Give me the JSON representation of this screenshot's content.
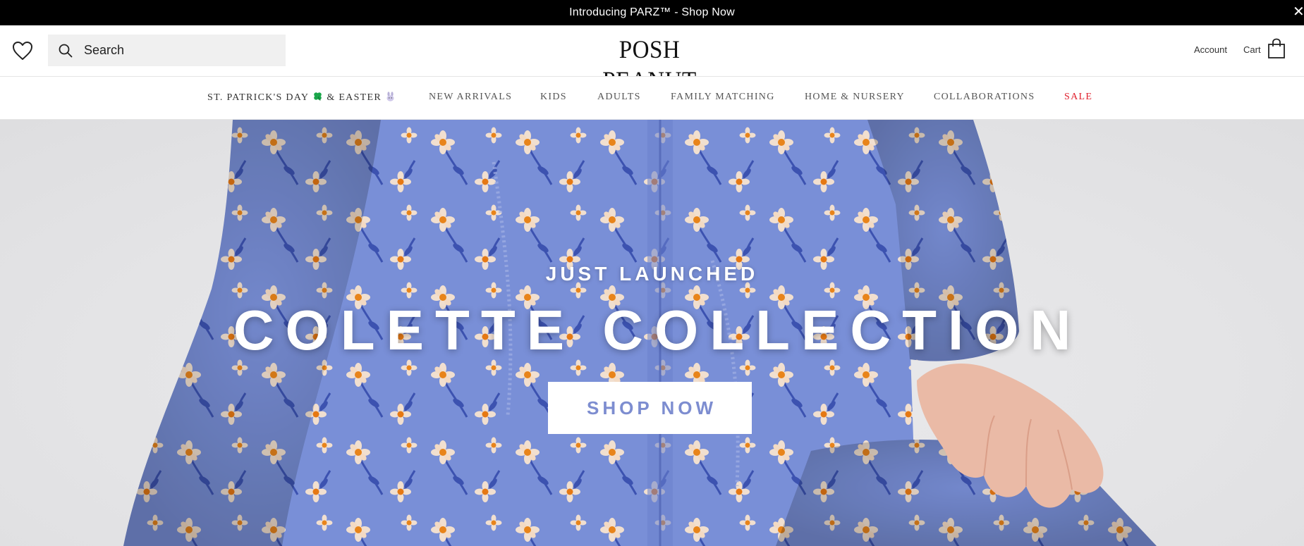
{
  "announcement": {
    "text": "Introducing PARZ™ - Shop Now",
    "close_glyph": "✕"
  },
  "header": {
    "search_placeholder": "Search",
    "logo": "POSH PEANUT",
    "account_label": "Account",
    "cart_label": "Cart",
    "icons": {
      "wishlist": "heart-icon",
      "search": "search-icon",
      "cart": "shopping-bag-icon"
    }
  },
  "nav": {
    "items": [
      {
        "label": "ST. PATRICK'S DAY",
        "suffix": "& EASTER"
      },
      {
        "label": "NEW ARRIVALS"
      },
      {
        "label": "KIDS"
      },
      {
        "label": "ADULTS"
      },
      {
        "label": "FAMILY MATCHING"
      },
      {
        "label": "HOME & NURSERY"
      },
      {
        "label": "COLLABORATIONS"
      },
      {
        "label": "SALE"
      }
    ],
    "icons": {
      "clover": "four-leaf-clover-icon",
      "bunny": "bunny-icon"
    },
    "sale_color": "#e0202d"
  },
  "hero": {
    "eyebrow": "JUST LAUNCHED",
    "title": "COLETTE COLLECTION",
    "button_label": "SHOP NOW",
    "fabric_color": "#7e95e0",
    "button_text_color": "#7d8dd0"
  }
}
